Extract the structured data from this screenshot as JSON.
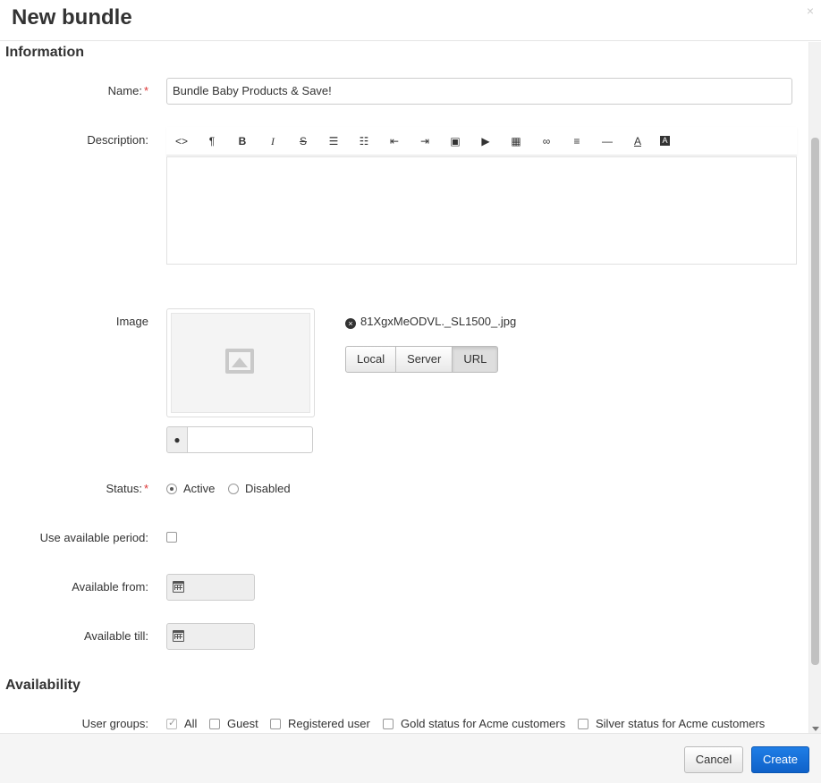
{
  "dialog": {
    "title": "New bundle",
    "close_icon": "×"
  },
  "sections": {
    "information": "Information",
    "availability": "Availability"
  },
  "fields": {
    "name_label": "Name:",
    "name_required": "*",
    "name_value": "Bundle Baby Products & Save!",
    "description_label": "Description:",
    "image_label": "Image",
    "status_label": "Status:",
    "status_required": "*",
    "use_period_label": "Use available period:",
    "available_from_label": "Available from:",
    "available_till_label": "Available till:",
    "user_groups_label": "User groups:"
  },
  "editor": {
    "toolbar": [
      {
        "name": "code-icon",
        "glyph": "<>"
      },
      {
        "name": "paragraph-icon",
        "glyph": "¶"
      },
      {
        "name": "bold-icon",
        "glyph": "B"
      },
      {
        "name": "italic-icon",
        "glyph": "I"
      },
      {
        "name": "strikethrough-icon",
        "glyph": "S"
      },
      {
        "name": "unordered-list-icon",
        "glyph": "☰"
      },
      {
        "name": "ordered-list-icon",
        "glyph": "☷"
      },
      {
        "name": "outdent-icon",
        "glyph": "⇤"
      },
      {
        "name": "indent-icon",
        "glyph": "⇥"
      },
      {
        "name": "image-icon",
        "glyph": "▣"
      },
      {
        "name": "video-icon",
        "glyph": "▶"
      },
      {
        "name": "table-icon",
        "glyph": "▦"
      },
      {
        "name": "link-icon",
        "glyph": "∞"
      },
      {
        "name": "align-icon",
        "glyph": "≡"
      },
      {
        "name": "horizontal-rule-icon",
        "glyph": "—"
      },
      {
        "name": "font-color-icon",
        "glyph": "A"
      },
      {
        "name": "background-color-icon",
        "glyph": "A"
      }
    ]
  },
  "image": {
    "file_name": "81XgxMeODVL._SL1500_.jpg",
    "remove_icon": "×",
    "comment_icon": "💬",
    "sources": [
      "Local",
      "Server",
      "URL"
    ],
    "active_source": "URL"
  },
  "status": {
    "options": [
      "Active",
      "Disabled"
    ],
    "selected": "Active"
  },
  "user_groups": {
    "options": [
      "All",
      "Guest",
      "Registered user",
      "Gold status for Acme customers",
      "Silver status for Acme customers"
    ],
    "checked": [
      "All"
    ]
  },
  "footer": {
    "cancel_label": "Cancel",
    "create_label": "Create"
  },
  "colors": {
    "primary": "#1570d9",
    "required": "#dd3333"
  }
}
